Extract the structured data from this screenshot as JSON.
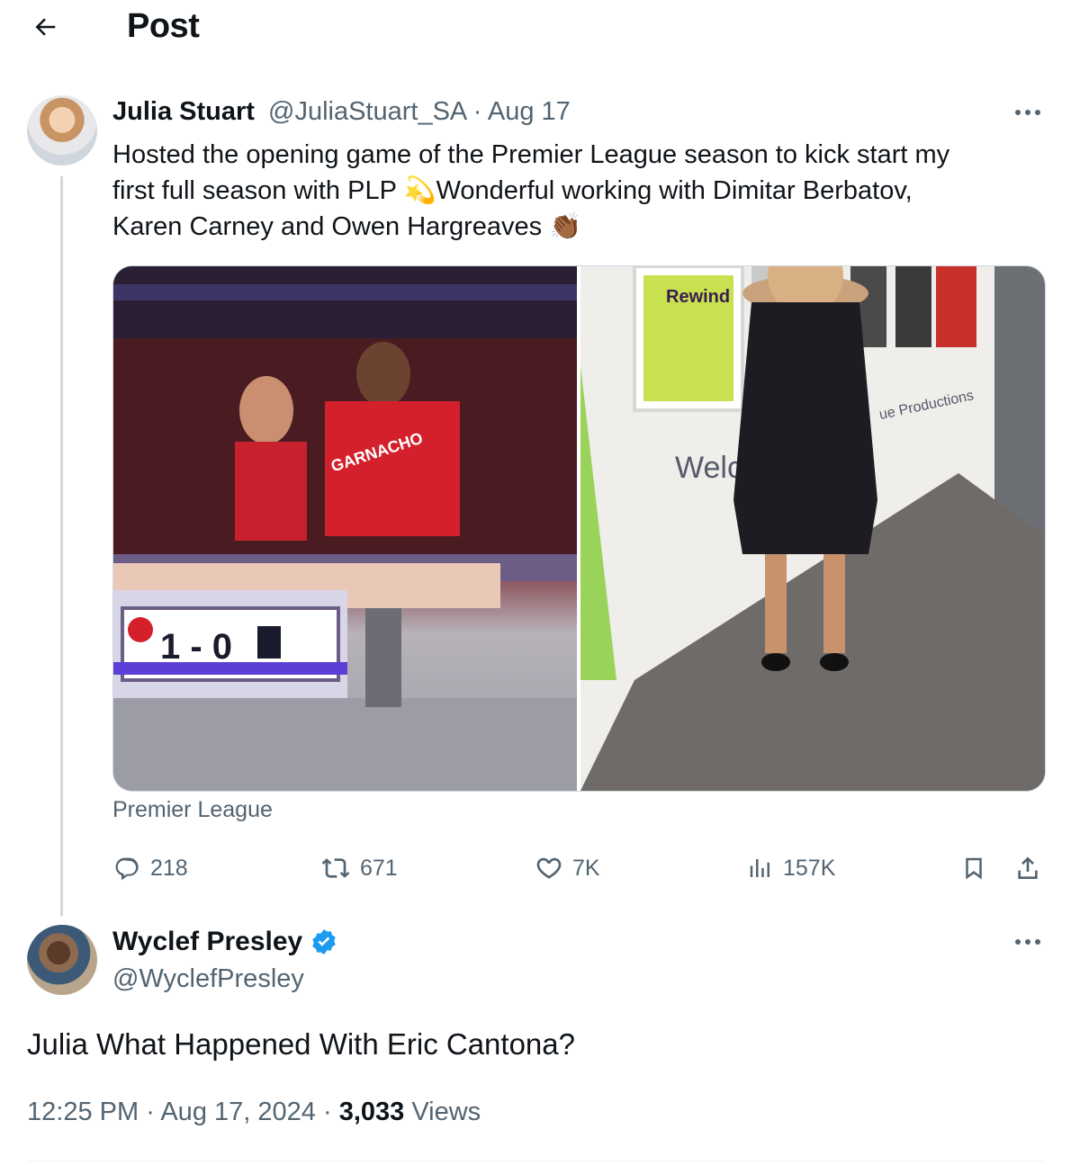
{
  "header": {
    "title": "Post",
    "back_icon": "arrow-left-icon"
  },
  "tweet": {
    "author_name": "Julia Stuart",
    "author_handle": "@JuliaStuart_SA",
    "separator": "·",
    "date": "Aug 17",
    "text_line1": "Hosted the opening game of the Premier League season to kick start my",
    "text_line2a": "first full season with PLP ",
    "emoji_star": "💫",
    "text_line2b": "Wonderful working with Dimitar Berbatov,",
    "text_line3": "Karen Carney and Owen Hargreaves ",
    "emoji_clap": "👏🏾",
    "media": {
      "left": {
        "scoreboard": "1 - 0",
        "shirt_text": "GARNACHO"
      },
      "right": {
        "frame_text": "Rewind",
        "wall_text": "Welc",
        "wall_text2": "ue Productions"
      }
    },
    "source_label": "Premier League",
    "stats": {
      "replies": "218",
      "reposts": "671",
      "likes": "7K",
      "views": "157K"
    }
  },
  "reply": {
    "author_name": "Wyclef Presley",
    "author_handle": "@WyclefPresley",
    "verified": true,
    "text": "Julia What Happened With Eric Cantona?",
    "time": "12:25 PM",
    "date": "Aug 17, 2024",
    "views_count": "3,033",
    "views_label": "Views",
    "separator": "·"
  },
  "colors": {
    "text": "#0f1419",
    "secondary": "#536471",
    "border": "#cfd9de",
    "verified": "#1d9bf0"
  }
}
